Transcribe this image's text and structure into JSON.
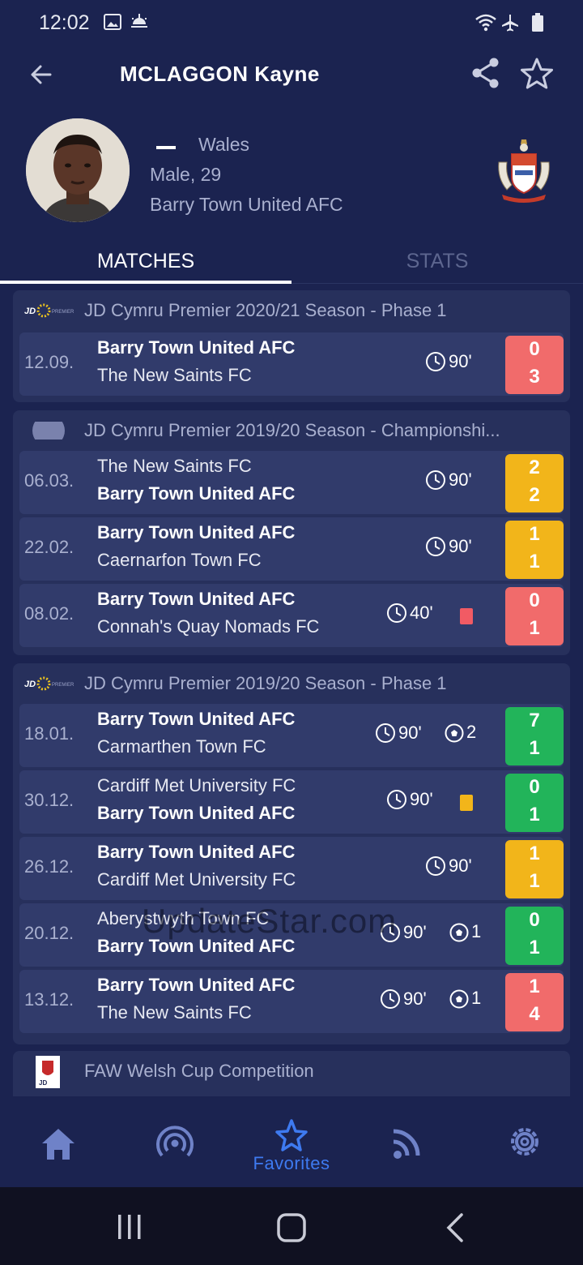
{
  "status_bar": {
    "time": "12:02"
  },
  "header": {
    "title": "MCLAGGON Kayne"
  },
  "profile": {
    "country": "Wales",
    "gender_age": "Male, 29",
    "club": "Barry Town United AFC"
  },
  "tabs": {
    "matches": "MATCHES",
    "stats": "STATS"
  },
  "groups": [
    {
      "title": "JD Cymru Premier 2020/21 Season - Phase 1",
      "matches": [
        {
          "date": "12.09.",
          "home": "Barry Town United AFC",
          "away": "The New Saints FC",
          "minutes": "90'",
          "home_score": "0",
          "away_score": "3",
          "result": "loss"
        }
      ]
    },
    {
      "title": "JD Cymru Premier 2019/20 Season - Championshi...",
      "matches": [
        {
          "date": "06.03.",
          "home": "The New Saints FC",
          "away": "Barry Town United AFC",
          "minutes": "90'",
          "home_score": "2",
          "away_score": "2",
          "result": "draw"
        },
        {
          "date": "22.02.",
          "home": "Barry Town United AFC",
          "away": "Caernarfon Town FC",
          "minutes": "90'",
          "home_score": "1",
          "away_score": "1",
          "result": "draw"
        },
        {
          "date": "08.02.",
          "home": "Barry Town United AFC",
          "away": "Connah's Quay Nomads FC",
          "minutes": "40'",
          "card": "red",
          "home_score": "0",
          "away_score": "1",
          "result": "loss"
        }
      ]
    },
    {
      "title": "JD Cymru Premier 2019/20 Season - Phase 1",
      "matches": [
        {
          "date": "18.01.",
          "home": "Barry Town United AFC",
          "away": "Carmarthen Town FC",
          "minutes": "90'",
          "goals": "2",
          "home_score": "7",
          "away_score": "1",
          "result": "win"
        },
        {
          "date": "30.12.",
          "home": "Cardiff Met University FC",
          "away": "Barry Town United AFC",
          "minutes": "90'",
          "card": "yellow",
          "home_score": "0",
          "away_score": "1",
          "result": "win"
        },
        {
          "date": "26.12.",
          "home": "Barry Town United AFC",
          "away": "Cardiff Met University FC",
          "minutes": "90'",
          "home_score": "1",
          "away_score": "1",
          "result": "draw"
        },
        {
          "date": "20.12.",
          "home": "Aberystwyth Town FC",
          "away": "Barry Town United AFC",
          "minutes": "90'",
          "goals": "1",
          "home_score": "0",
          "away_score": "1",
          "result": "win"
        },
        {
          "date": "13.12.",
          "home": "Barry Town United AFC",
          "away": "The New Saints FC",
          "minutes": "90'",
          "goals": "1",
          "home_score": "1",
          "away_score": "4",
          "result": "loss"
        }
      ]
    },
    {
      "title": "FAW Welsh Cup Competition",
      "matches": []
    }
  ],
  "watermark": "UpdateStar.com",
  "bottom_nav": {
    "favorites_label": "Favorites",
    "active": "favorites"
  },
  "colors": {
    "background": "#1b2350",
    "card": "#27305c",
    "row": "#313b6b",
    "accent": "#3e7af0",
    "win": "#22b45a",
    "draw": "#f2b51a",
    "loss": "#f16b6b"
  },
  "icons": [
    "back-arrow-icon",
    "share-icon",
    "star-outline-icon",
    "clock-icon",
    "ball-icon",
    "home-icon",
    "live-icon",
    "star-icon",
    "feed-icon",
    "gear-icon"
  ]
}
